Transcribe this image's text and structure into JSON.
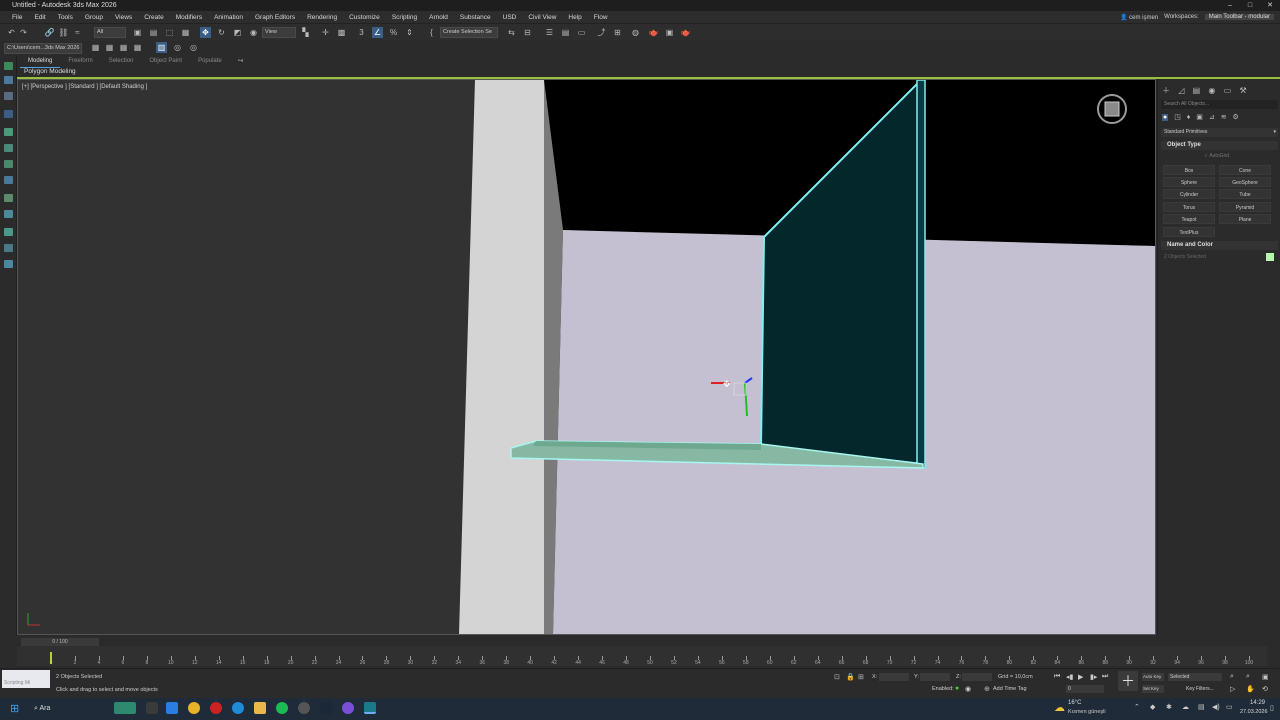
{
  "window": {
    "title": "Untitled - Autodesk 3ds Max 2026",
    "controls": [
      "–",
      "□",
      "✕"
    ]
  },
  "menu": {
    "items": [
      "File",
      "Edit",
      "Tools",
      "Group",
      "Views",
      "Create",
      "Modifiers",
      "Animation",
      "Graph Editors",
      "Rendering",
      "Customize",
      "Scripting",
      "Arnold",
      "Substance",
      "USD",
      "Civil View",
      "Help",
      "Flow"
    ],
    "user": "cem işmen",
    "workspaces_label": "Workspaces:",
    "workspace": "Main Toolbar - modular"
  },
  "toolbar": {
    "selection_filter": "All",
    "ref_coord": "View",
    "named_selection": "Create Selection Se"
  },
  "toolbar2": {
    "path": "C:\\Users\\cem...3ds Max 2026"
  },
  "ribbon": {
    "tabs": [
      "Modeling",
      "Freeform",
      "Selection",
      "Object Paint",
      "Populate"
    ],
    "active": "Modeling",
    "panel_label": "Polygon Modeling"
  },
  "viewport": {
    "label": "[+] [Perspective ] [Standard ] [Default Shading ]"
  },
  "command_panel": {
    "search_placeholder": "Search All Objects...",
    "category": "Standard Primitives",
    "object_type_title": "Object Type",
    "autogrid": "AutoGrid",
    "primitives": [
      "Box",
      "Cone",
      "Sphere",
      "GeoSphere",
      "Cylinder",
      "Tube",
      "Torus",
      "Pyramid",
      "Teapot",
      "Plane",
      "TextPlus"
    ],
    "name_color_title": "Name and Color",
    "name_value": "2 Objects Selected",
    "color": "#b9f5b0"
  },
  "timeline": {
    "frame_counter": "0 / 100",
    "ticks": [
      "0",
      "2",
      "4",
      "6",
      "8",
      "10",
      "12",
      "14",
      "16",
      "18",
      "20",
      "22",
      "24",
      "26",
      "28",
      "30",
      "32",
      "34",
      "36",
      "38",
      "40",
      "42",
      "44",
      "46",
      "48",
      "50",
      "52",
      "54",
      "56",
      "58",
      "60",
      "62",
      "64",
      "66",
      "68",
      "70",
      "72",
      "74",
      "76",
      "78",
      "80",
      "82",
      "84",
      "86",
      "88",
      "90",
      "92",
      "94",
      "96",
      "98",
      "100"
    ]
  },
  "status": {
    "maxscript": "Scripting Mi",
    "selected": "2 Objects Selected",
    "prompt": "Click and drag to select and move objects",
    "x_label": "X:",
    "y_label": "Y:",
    "z_label": "Z:",
    "grid": "Grid = 10,0cm",
    "enabled": "Enabled:",
    "add_time_tag": "Add Time Tag",
    "auto_key": "Auto Key",
    "set_key": "Set Key",
    "selected_dd": "Selected",
    "key_filters": "Key Filters...",
    "frame": "0"
  },
  "taskbar": {
    "search": "Ara",
    "weather_temp": "16°C",
    "weather_text": "Kısmen güneşli",
    "time": "14:29",
    "date": "27.03.2026"
  }
}
